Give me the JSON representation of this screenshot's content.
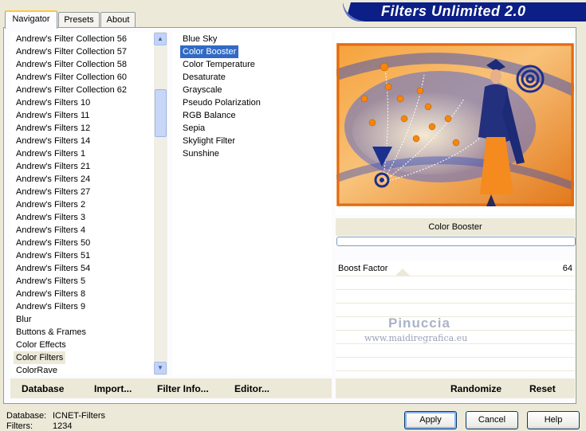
{
  "header": {
    "title": "Filters Unlimited 2.0"
  },
  "tabs": [
    {
      "label": "Navigator"
    },
    {
      "label": "Presets"
    },
    {
      "label": "About"
    }
  ],
  "categories": [
    "Andrew's Filter Collection 56",
    "Andrew's Filter Collection 57",
    "Andrew's Filter Collection 58",
    "Andrew's Filter Collection 60",
    "Andrew's Filter Collection 62",
    "Andrew's Filters 10",
    "Andrew's Filters 11",
    "Andrew's Filters 12",
    "Andrew's Filters 14",
    "Andrew's Filters 1",
    "Andrew's Filters 21",
    "Andrew's Filters 24",
    "Andrew's Filters 27",
    "Andrew's Filters 2",
    "Andrew's Filters 3",
    "Andrew's Filters 4",
    "Andrew's Filters 50",
    "Andrew's Filters 51",
    "Andrew's Filters 54",
    "Andrew's Filters 5",
    "Andrew's Filters 8",
    "Andrew's Filters 9",
    "Blur",
    "Buttons & Frames",
    "Color Effects",
    "Color Filters",
    "ColorRave"
  ],
  "selected_category": "Color Filters",
  "filters": [
    "Blue Sky",
    "Color Booster",
    "Color Temperature",
    "Desaturate",
    "Grayscale",
    "Pseudo Polarization",
    "RGB Balance",
    "Sepia",
    "Skylight Filter",
    "Sunshine"
  ],
  "selected_filter": "Color Booster",
  "preview": {
    "filter_name": "Color Booster",
    "watermark_name": "Pinuccia",
    "watermark_url": "www.maidiregrafica.eu"
  },
  "parameters": [
    {
      "label": "Boost Factor",
      "value": "64",
      "slider_fraction": 0.25
    }
  ],
  "toolbar": {
    "database": "Database",
    "import": "Import...",
    "filter_info": "Filter Info...",
    "editor": "Editor...",
    "randomize": "Randomize",
    "reset": "Reset"
  },
  "status": {
    "database_label": "Database:",
    "database_value": "ICNET-Filters",
    "filters_label": "Filters:",
    "filters_value": "1234"
  },
  "buttons": {
    "apply": "Apply",
    "cancel": "Cancel",
    "help": "Help"
  },
  "colors": {
    "title_bar": "#0b1f86",
    "selection_blue": "#316ac5",
    "accent_orange": "#f58a1f"
  }
}
